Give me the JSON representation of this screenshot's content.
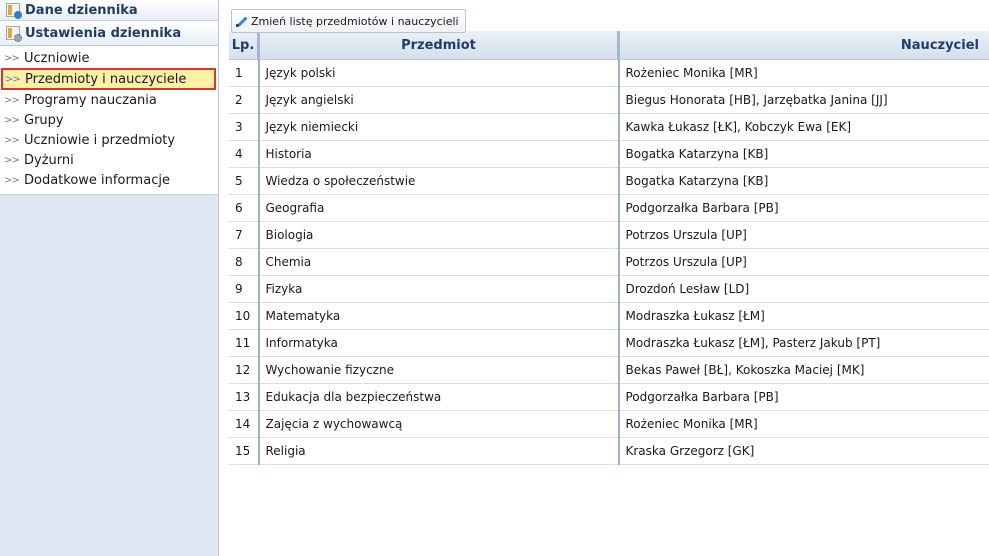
{
  "sidebar": {
    "header_dane": "Dane dziennika",
    "header_ustawienia": "Ustawienia dziennika",
    "items": [
      {
        "label": "Uczniowie",
        "active": false
      },
      {
        "label": "Przedmioty i nauczyciele",
        "active": true
      },
      {
        "label": "Programy nauczania",
        "active": false
      },
      {
        "label": "Grupy",
        "active": false
      },
      {
        "label": "Uczniowie i przedmioty",
        "active": false
      },
      {
        "label": "Dyżurni",
        "active": false
      },
      {
        "label": "Dodatkowe informacje",
        "active": false
      }
    ]
  },
  "toolbar": {
    "edit_label": "Zmień listę przedmiotów i nauczycieli",
    "edit_icon": "pencil-icon"
  },
  "table": {
    "headers": {
      "lp": "Lp.",
      "przedmiot": "Przedmiot",
      "nauczyciel": "Nauczyciel"
    },
    "rows": [
      {
        "lp": "1",
        "przedmiot": "Język polski",
        "nauczyciel": "Rożeniec Monika [MR]"
      },
      {
        "lp": "2",
        "przedmiot": "Język angielski",
        "nauczyciel": "Biegus Honorata [HB], Jarzębatka Janina [JJ]"
      },
      {
        "lp": "3",
        "przedmiot": "Język niemiecki",
        "nauczyciel": "Kawka Łukasz [ŁK], Kobczyk Ewa [EK]"
      },
      {
        "lp": "4",
        "przedmiot": "Historia",
        "nauczyciel": "Bogatka Katarzyna [KB]"
      },
      {
        "lp": "5",
        "przedmiot": "Wiedza o społeczeństwie",
        "nauczyciel": "Bogatka Katarzyna [KB]"
      },
      {
        "lp": "6",
        "przedmiot": "Geografia",
        "nauczyciel": "Podgorzałka Barbara [PB]"
      },
      {
        "lp": "7",
        "przedmiot": "Biologia",
        "nauczyciel": "Potrzos Urszula [UP]"
      },
      {
        "lp": "8",
        "przedmiot": "Chemia",
        "nauczyciel": "Potrzos Urszula [UP]"
      },
      {
        "lp": "9",
        "przedmiot": "Fizyka",
        "nauczyciel": "Drozdoń Lesław [LD]"
      },
      {
        "lp": "10",
        "przedmiot": "Matematyka",
        "nauczyciel": "Modraszka Łukasz [ŁM]"
      },
      {
        "lp": "11",
        "przedmiot": "Informatyka",
        "nauczyciel": "Modraszka Łukasz [ŁM], Pasterz Jakub [PT]"
      },
      {
        "lp": "12",
        "przedmiot": "Wychowanie fizyczne",
        "nauczyciel": "Bekas Paweł [BŁ], Kokoszka Maciej [MK]"
      },
      {
        "lp": "13",
        "przedmiot": "Edukacja dla bezpieczeństwa",
        "nauczyciel": "Podgorzałka Barbara [PB]"
      },
      {
        "lp": "14",
        "przedmiot": "Zajęcia z wychowawcą",
        "nauczyciel": "Rożeniec Monika [MR]"
      },
      {
        "lp": "15",
        "przedmiot": "Religia",
        "nauczyciel": "Kraska Grzegorz [GK]"
      }
    ]
  },
  "colors": {
    "active_bg": "#fdf1a6",
    "active_border": "#e0332c",
    "header_text": "#1f3d6b",
    "sidebar_bg": "#dfe8f2"
  }
}
